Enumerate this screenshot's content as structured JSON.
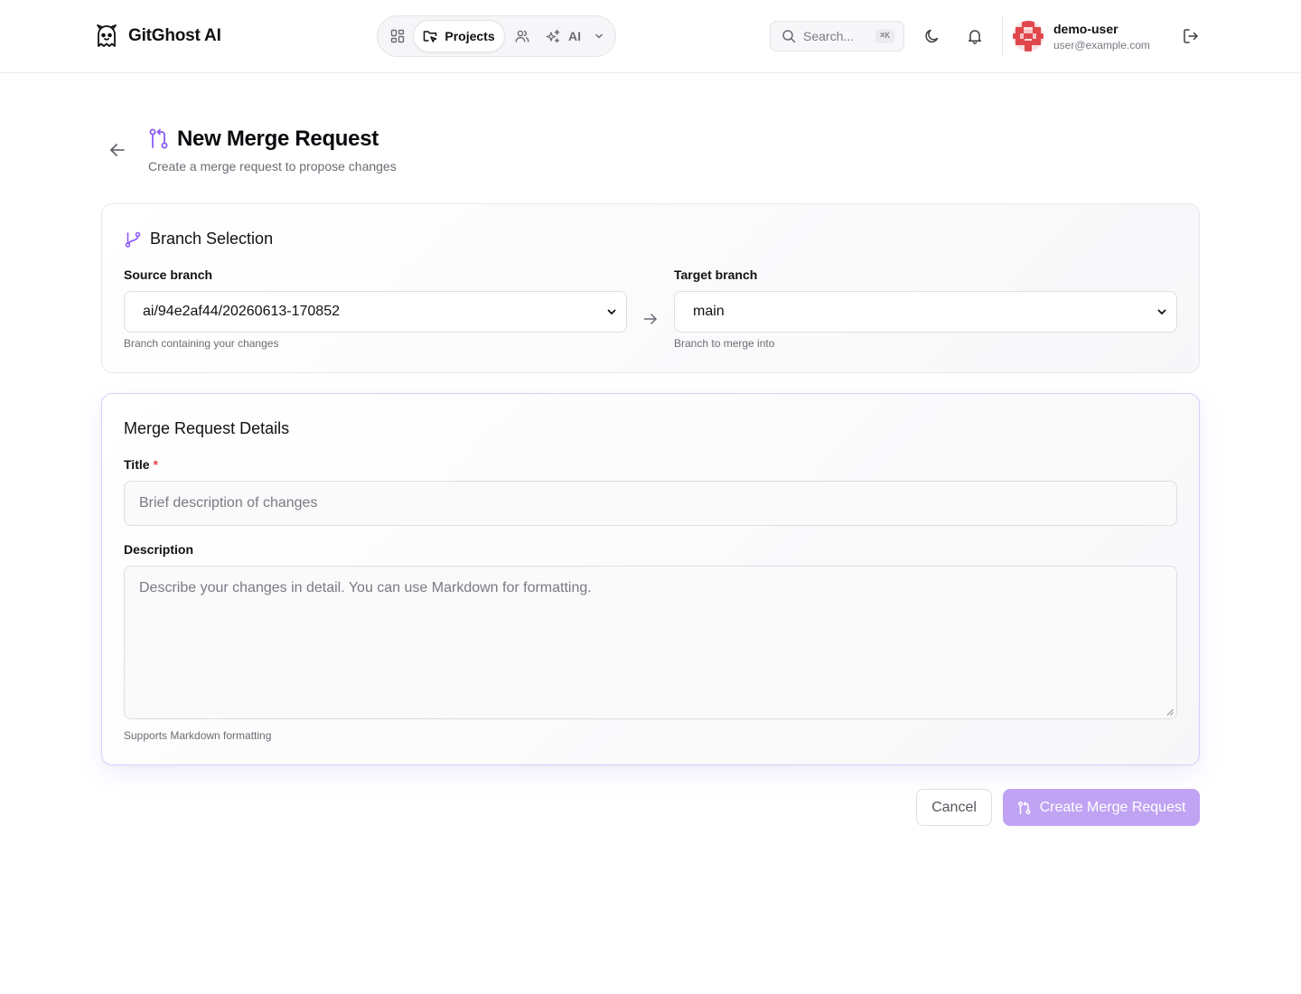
{
  "brand": {
    "name": "GitGhost AI",
    "logo_icon": "ghost-icon"
  },
  "nav": {
    "items": [
      {
        "icon": "dashboard-icon",
        "label": ""
      },
      {
        "icon": "projects-folder-icon",
        "label": "Projects",
        "active": true
      },
      {
        "icon": "users-icon",
        "label": ""
      },
      {
        "icon": "sparkles-icon",
        "label": "AI",
        "dropdown": true
      }
    ]
  },
  "search": {
    "placeholder": "Search...",
    "shortcut": "⌘K"
  },
  "user": {
    "name": "demo-user",
    "email": "user@example.com"
  },
  "page": {
    "title": "New Merge Request",
    "subtitle": "Create a merge request to propose changes"
  },
  "branch_selection": {
    "heading": "Branch Selection",
    "source": {
      "label": "Source branch",
      "value": "ai/94e2af44/20260613-170852",
      "hint": "Branch containing your changes"
    },
    "target": {
      "label": "Target branch",
      "value": "main",
      "hint": "Branch to merge into"
    }
  },
  "details": {
    "heading": "Merge Request Details",
    "title_field": {
      "label": "Title",
      "required_mark": "*",
      "placeholder": "Brief description of changes",
      "value": ""
    },
    "description_field": {
      "label": "Description",
      "placeholder": "Describe your changes in detail. You can use Markdown for formatting.",
      "value": "",
      "hint": "Supports Markdown formatting"
    }
  },
  "actions": {
    "cancel_label": "Cancel",
    "create_label": "Create Merge Request"
  },
  "colors": {
    "accent": "#8b5cf6",
    "create_button_disabled": "#c0a3f2",
    "required": "#e5484d"
  }
}
